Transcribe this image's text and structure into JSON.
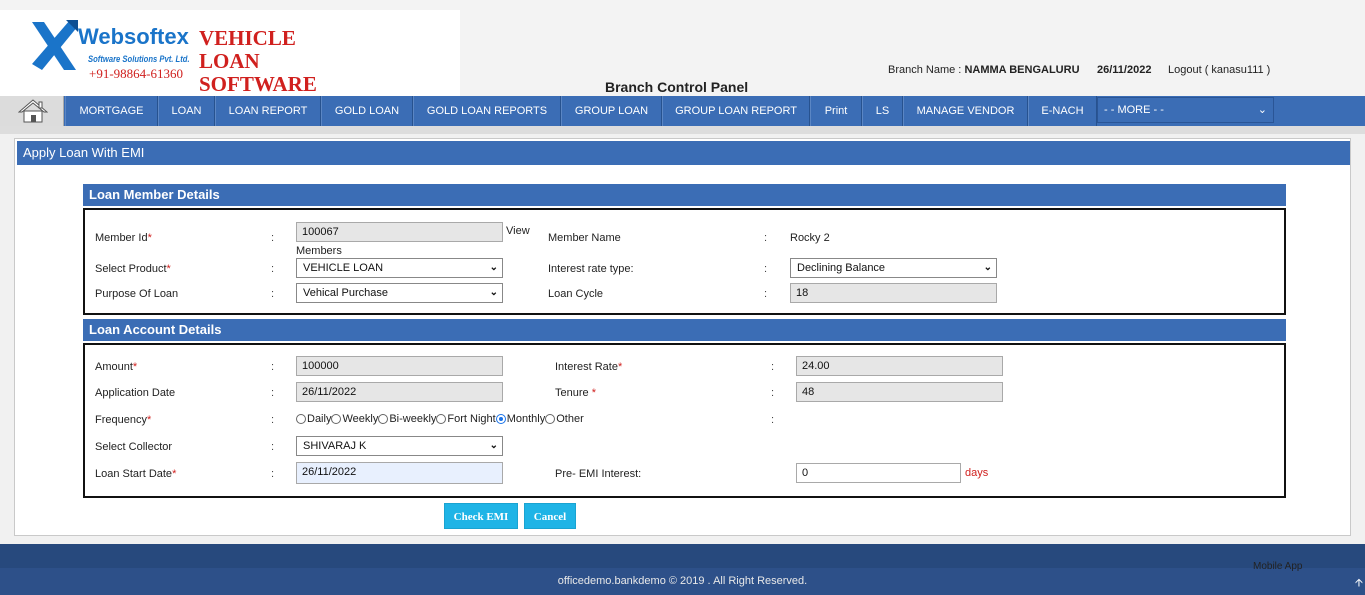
{
  "header": {
    "logo_name": "Websoftex",
    "logo_sub": "Software Solutions Pvt. Ltd.",
    "logo_phone": "+91-98864-61360",
    "product_line1": "VEHICLE",
    "product_line2": "LOAN",
    "product_line3": "SOFTWARE",
    "panel_title": "Branch Control Panel",
    "branch_label": "Branch Name :",
    "branch_value": "NAMMA BENGALURU",
    "date": "26/11/2022",
    "logout": "Logout ( kanasu111 )"
  },
  "nav": {
    "home_icon": "home-icon",
    "items": [
      "MORTGAGE",
      "LOAN",
      "LOAN REPORT",
      "GOLD LOAN",
      "GOLD LOAN REPORTS",
      "GROUP LOAN",
      "GROUP LOAN REPORT",
      "Print",
      "LS",
      "MANAGE VENDOR",
      "E-NACH"
    ],
    "more": "- - MORE - -"
  },
  "page": {
    "title": "Apply Loan With EMI"
  },
  "member_section": {
    "heading": "Loan Member Details",
    "member_id_label": "Member Id",
    "member_id_value": "100067",
    "view_members_1": "View",
    "view_members_2": "Members",
    "member_name_label": "Member Name",
    "member_name_value": "Rocky 2",
    "product_label": "Select Product",
    "product_value": "VEHICLE LOAN",
    "rate_type_label": "Interest rate type:",
    "rate_type_value": "Declining Balance",
    "purpose_label": "Purpose Of Loan",
    "purpose_value": "Vehical Purchase",
    "cycle_label": "Loan Cycle",
    "cycle_value": "18"
  },
  "account_section": {
    "heading": "Loan Account Details",
    "amount_label": "Amount",
    "amount_value": "100000",
    "rate_label": "Interest Rate",
    "rate_value": "24.00",
    "app_date_label": "Application Date",
    "app_date_value": "26/11/2022",
    "tenure_label": "Tenure",
    "tenure_value": "48",
    "frequency_label": "Frequency",
    "frequency_options": [
      "Daily",
      "Weekly",
      "Bi-weekly",
      "Fort Night",
      "Monthly",
      "Other"
    ],
    "frequency_selected": "Monthly",
    "collector_label": "Select Collector",
    "collector_value": "SHIVARAJ K",
    "start_date_label": "Loan Start Date",
    "start_date_value": "26/11/2022",
    "pre_emi_label": "Pre- EMI Interest:",
    "pre_emi_value": "0",
    "pre_emi_unit": "days"
  },
  "actions": {
    "check_emi": "Check EMI",
    "cancel": "Cancel"
  },
  "footer": {
    "copyright": "officedemo.bankdemo © 2019 . All Right Reserved.",
    "mobile_app": "Mobile App"
  },
  "colors": {
    "nav_blue": "#3b6db5",
    "brand_red": "#d0201e",
    "brand_blue": "#1a74c9",
    "button_cyan": "#1fb4e6"
  }
}
